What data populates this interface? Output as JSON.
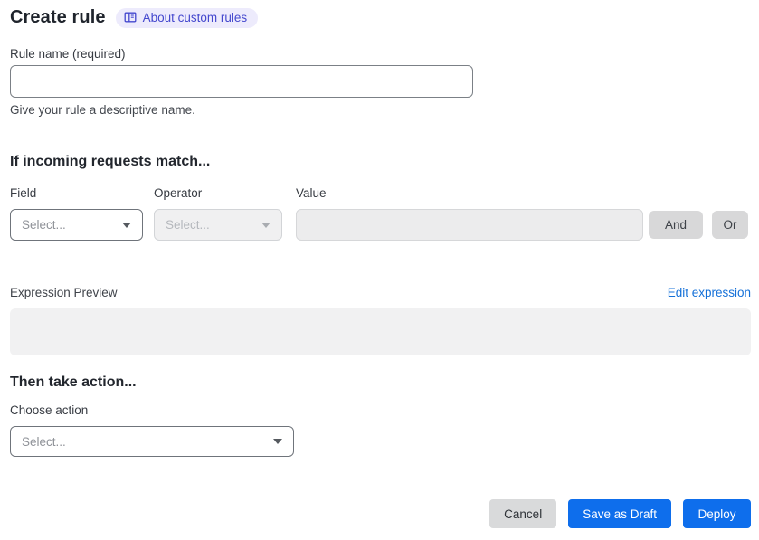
{
  "header": {
    "title": "Create rule",
    "about_badge_label": "About custom rules"
  },
  "rule_name": {
    "label": "Rule name (required)",
    "value": "",
    "placeholder": "",
    "helper": "Give your rule a descriptive name."
  },
  "match_section": {
    "heading": "If incoming requests match...",
    "field": {
      "label": "Field",
      "placeholder": "Select...",
      "enabled": true
    },
    "operator": {
      "label": "Operator",
      "placeholder": "Select...",
      "enabled": false
    },
    "value": {
      "label": "Value",
      "value": "",
      "enabled": false
    },
    "and_button": "And",
    "or_button": "Or"
  },
  "expression": {
    "label": "Expression Preview",
    "edit_link": "Edit expression",
    "content": ""
  },
  "action_section": {
    "heading": "Then take action...",
    "choose_label": "Choose action",
    "select_placeholder": "Select..."
  },
  "footer": {
    "cancel": "Cancel",
    "save_as_draft": "Save as Draft",
    "deploy": "Deploy"
  },
  "colors": {
    "primary_blue": "#0e6eec",
    "link_blue": "#1470d8",
    "badge_bg": "#edebfc",
    "badge_text": "#4448ce",
    "disabled_bg": "#f0f0f1",
    "chip_gray": "#d8d8d9",
    "preview_gray": "#f1f1f2"
  },
  "icons": {
    "about_icon": "book-open-icon",
    "select_caret": "caret-down-icon"
  }
}
